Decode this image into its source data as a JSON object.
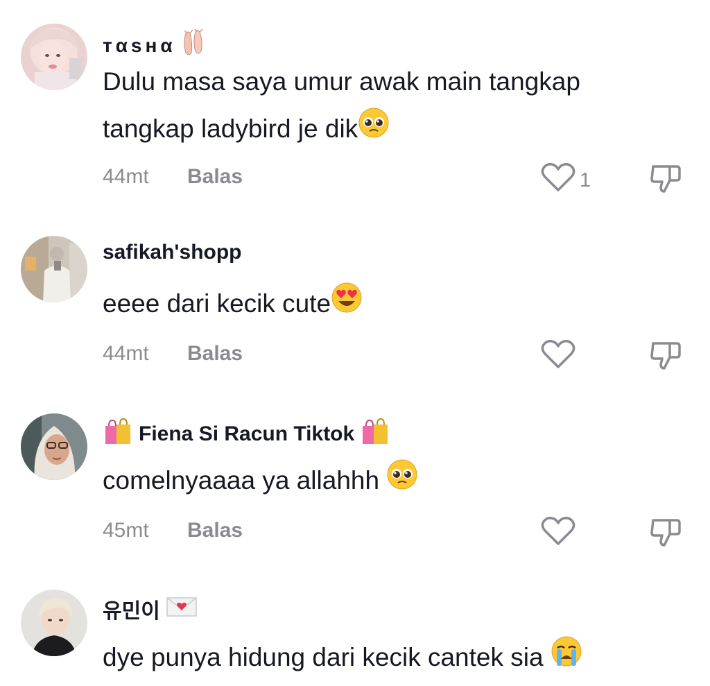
{
  "comments": [
    {
      "username": "ᴛαsʜα",
      "text": "Dulu masa saya umur awak main tangkap tangkap ladybird je dik",
      "time": "44mt",
      "reply_label": "Balas",
      "like_count": "1",
      "name_icon": "ballet-shoes-icon",
      "text_emoji": "pleading-face-icon"
    },
    {
      "username": "safikah'shopp",
      "text": "eeee dari kecik cute",
      "time": "44mt",
      "reply_label": "Balas",
      "like_count": "",
      "text_emoji": "heart-eyes-icon"
    },
    {
      "username": "Fiena Si Racun Tiktok",
      "text": "comelnyaaaa ya allahhh ",
      "time": "45mt",
      "reply_label": "Balas",
      "like_count": "",
      "name_icon": "shopping-bags-icon",
      "text_emoji": "pleading-face-icon"
    },
    {
      "username": "유민이",
      "text": "dye punya hidung dari kecik cantek sia ",
      "name_icon": "love-letter-icon",
      "text_emoji": "crying-face-icon"
    }
  ],
  "colors": {
    "text": "#161823",
    "meta": "#8a8b91"
  }
}
